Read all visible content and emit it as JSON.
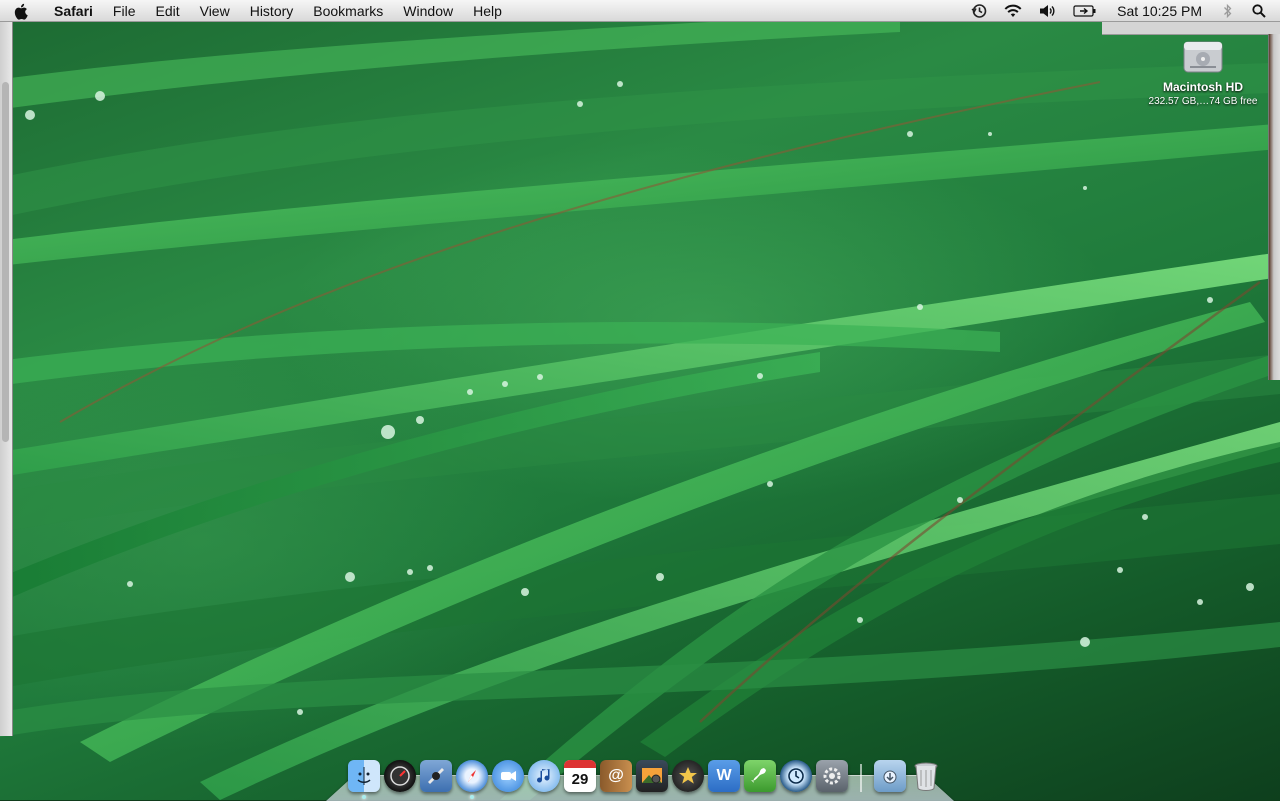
{
  "menubar": {
    "app_name": "Safari",
    "menus": [
      "File",
      "Edit",
      "View",
      "History",
      "Bookmarks",
      "Window",
      "Help"
    ],
    "clock": "Sat 10:25 PM",
    "status_icons": [
      "time-machine-icon",
      "wifi-icon",
      "volume-icon",
      "battery-icon",
      "bluetooth-icon",
      "spotlight-icon"
    ]
  },
  "desktop": {
    "wallpaper": "grass-with-dew",
    "drive": {
      "name": "Macintosh HD",
      "info": "232.57 GB,…74 GB free"
    }
  },
  "dock": {
    "apps": [
      {
        "id": "finder",
        "icon": "finder-icon"
      },
      {
        "id": "dashboard",
        "icon": "dashboard-icon"
      },
      {
        "id": "mail",
        "icon": "mail-icon"
      },
      {
        "id": "safari",
        "icon": "safari-icon"
      },
      {
        "id": "ichat",
        "icon": "ichat-icon"
      },
      {
        "id": "itunes",
        "icon": "itunes-icon"
      },
      {
        "id": "ical",
        "icon": "ical-icon",
        "badge": "29"
      },
      {
        "id": "address-book",
        "icon": "address-book-icon"
      },
      {
        "id": "iphoto",
        "icon": "iphoto-icon"
      },
      {
        "id": "imovie",
        "icon": "imovie-icon"
      },
      {
        "id": "iweb",
        "icon": "iweb-icon"
      },
      {
        "id": "garageband",
        "icon": "garageband-icon"
      },
      {
        "id": "time-machine",
        "icon": "time-machine-icon"
      },
      {
        "id": "system-preferences",
        "icon": "system-preferences-icon"
      }
    ],
    "stacks": [
      {
        "id": "downloads",
        "icon": "downloads-stack-icon"
      },
      {
        "id": "trash",
        "icon": "trash-icon"
      }
    ]
  },
  "colors": {
    "wallpaper_green": "#1f7a3b",
    "menubar_bg": "#e6e6e6"
  }
}
